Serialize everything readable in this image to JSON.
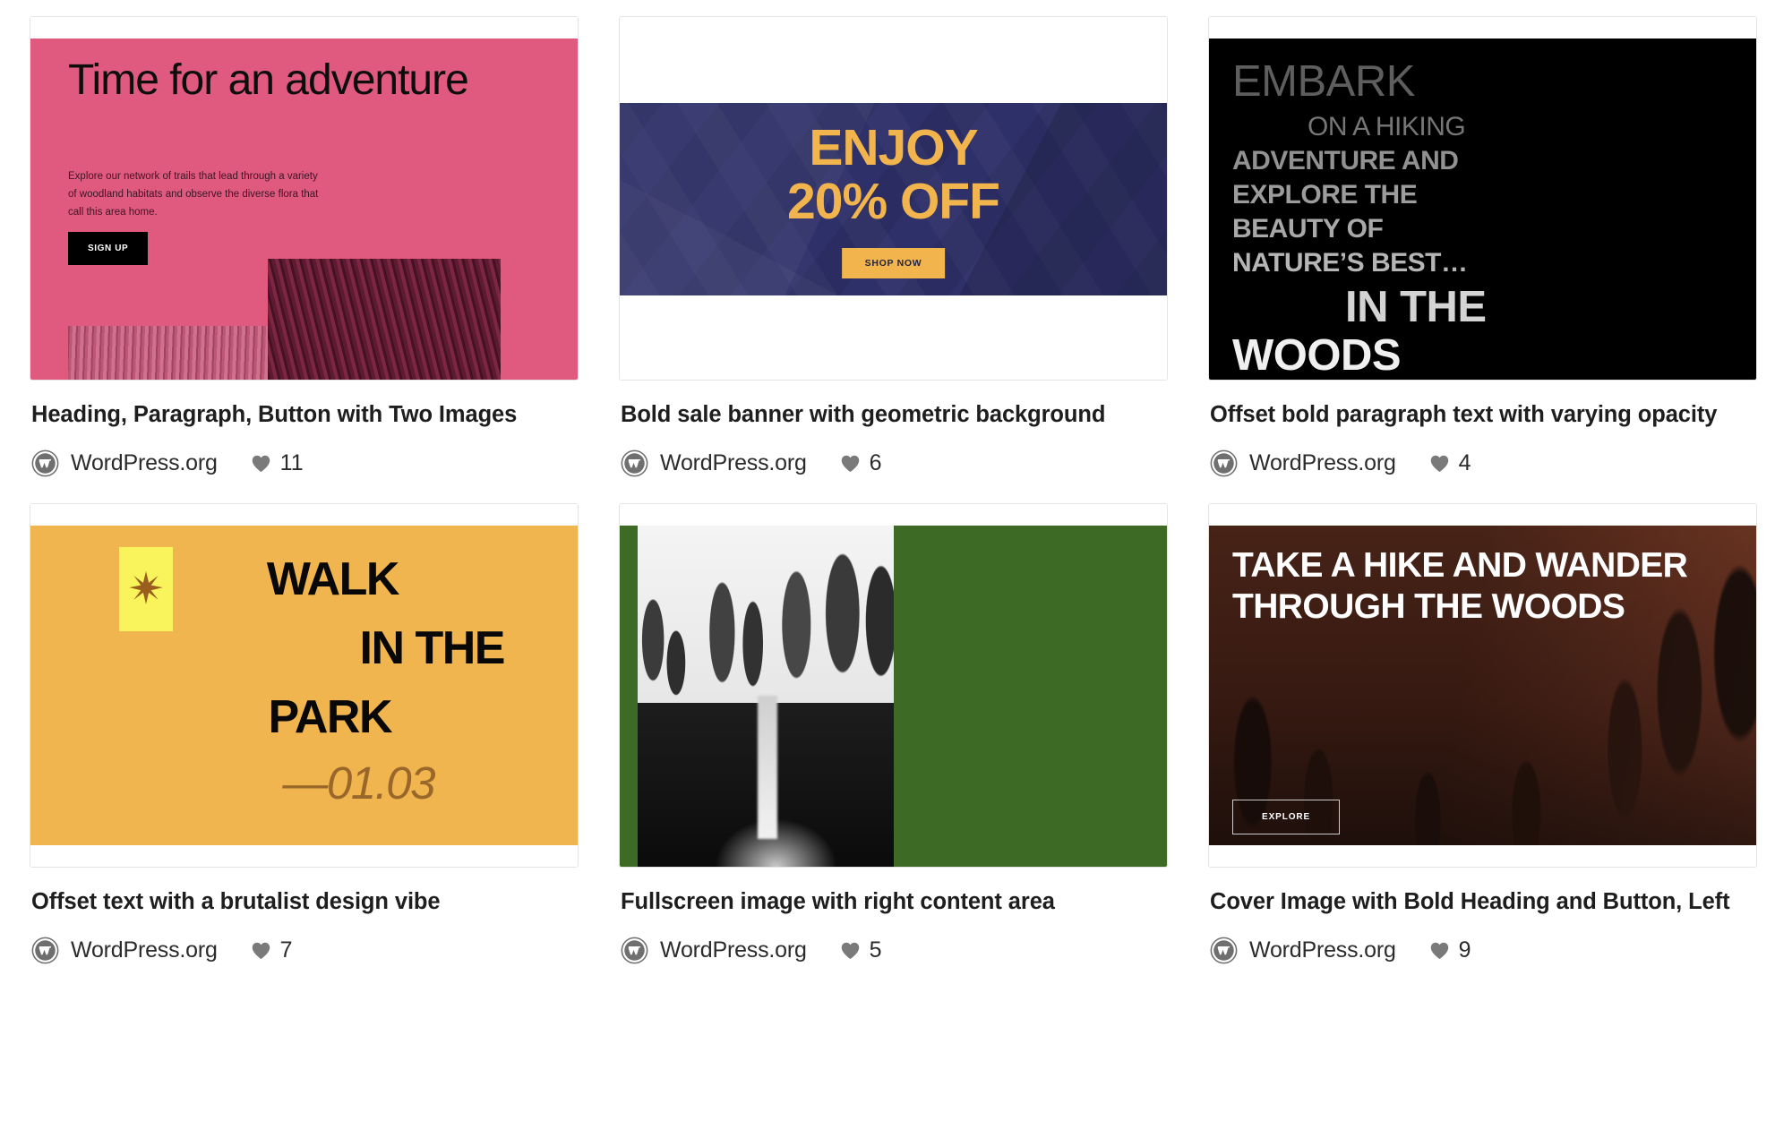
{
  "page": {
    "title": "WordPress Patterns Grid",
    "author_default": "WordPress.org"
  },
  "icons": {
    "wordpress": "wordpress-logo-icon",
    "like": "heart-icon",
    "star": "star-burst-icon"
  },
  "colors": {
    "card_border": "#e4e4e4",
    "title_text": "#1e1e1e",
    "meta_text": "#2b2b2b",
    "heart_gray": "#7a7a7a",
    "pink": "#e05a80",
    "navy": "#2e3069",
    "gold": "#f2b54e",
    "black": "#000000",
    "amber": "#f0b54f",
    "yellow": "#f9f35c",
    "brown": "#9a672b",
    "green": "#3d6b26",
    "rust": "#6d3424"
  },
  "cards": [
    {
      "id": "heading-paragraph-button-two-images",
      "title": "Heading, Paragraph, Button with Two Images",
      "author": "WordPress.org",
      "likes": "11",
      "preview": {
        "heading": "Time for an adventure",
        "paragraph": "Explore our network of trails that lead through a variety of woodland habitats and observe the diverse flora that call this area home.",
        "button": "SIGN UP"
      }
    },
    {
      "id": "bold-sale-banner-geometric-background",
      "title": "Bold sale banner with geometric background",
      "author": "WordPress.org",
      "likes": "6",
      "preview": {
        "line1": "ENJOY",
        "line2": "20% OFF",
        "button": "SHOP NOW"
      }
    },
    {
      "id": "offset-bold-paragraph-varying-opacity",
      "title": "Offset bold paragraph text with varying opacity",
      "author": "WordPress.org",
      "likes": "4",
      "preview": {
        "l1": "EMBARK",
        "l2": "ON A HIKING",
        "l3": "ADVENTURE AND",
        "l4": "EXPLORE THE",
        "l5": "BEAUTY OF",
        "l6": "NATURE’S BEST…",
        "l7": "IN THE",
        "l8": "WOODS"
      }
    },
    {
      "id": "offset-text-brutalist-design-vibe",
      "title": "Offset text with a brutalist design vibe",
      "author": "WordPress.org",
      "likes": "7",
      "preview": {
        "l1": "WALK",
        "l2": "IN THE",
        "l3": "PARK",
        "l4": "—01.03"
      }
    },
    {
      "id": "fullscreen-image-right-content-area",
      "title": "Fullscreen image with right content area",
      "author": "WordPress.org",
      "likes": "5",
      "preview": {
        "description": "Grayscale waterfall photograph on dark green background"
      }
    },
    {
      "id": "cover-image-bold-heading-button-left",
      "title": "Cover Image with Bold Heading and Button, Left",
      "author": "WordPress.org",
      "likes": "9",
      "preview": {
        "heading": "Take a hike and wander through the woods",
        "button": "EXPLORE"
      }
    }
  ]
}
